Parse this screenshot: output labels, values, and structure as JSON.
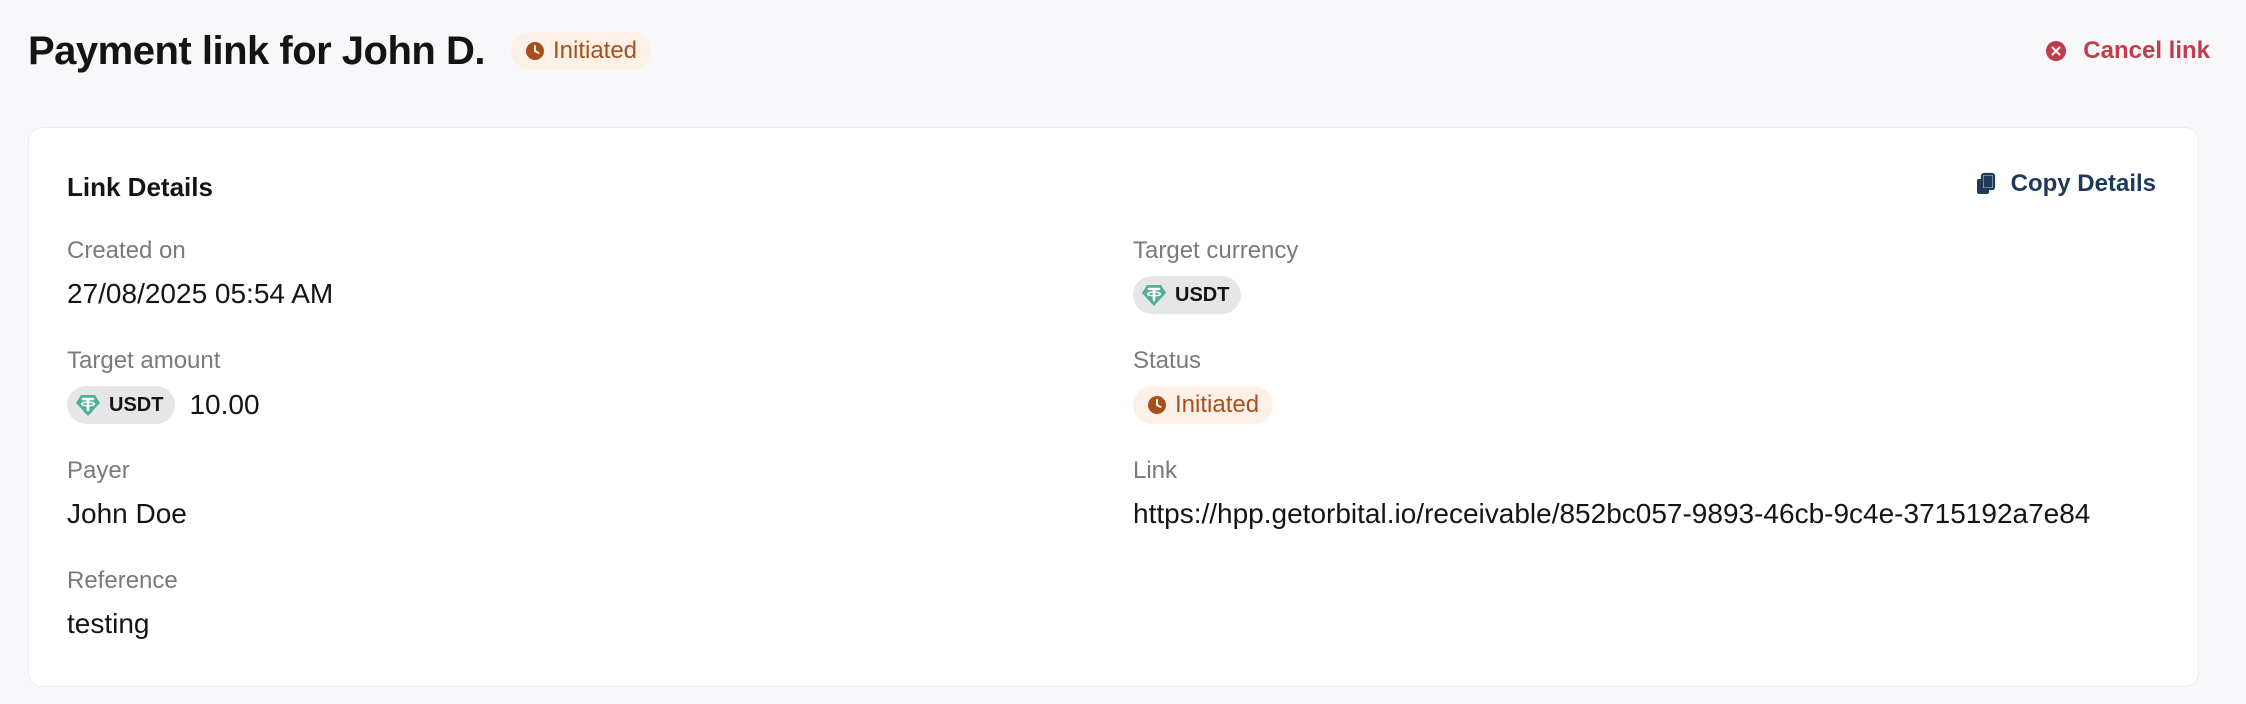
{
  "header": {
    "title": "Payment link for John D.",
    "status": "Initiated",
    "cancel_label": "Cancel link"
  },
  "card": {
    "title": "Link Details",
    "copy_label": "Copy Details",
    "fields": {
      "created_on": {
        "label": "Created on",
        "value": "27/08/2025 05:54 AM"
      },
      "target_amount": {
        "label": "Target amount",
        "currency": "USDT",
        "value": "10.00"
      },
      "payer": {
        "label": "Payer",
        "value": "John Doe"
      },
      "reference": {
        "label": "Reference",
        "value": "testing"
      },
      "target_currency": {
        "label": "Target currency",
        "currency": "USDT"
      },
      "status": {
        "label": "Status",
        "value": "Initiated"
      },
      "link": {
        "label": "Link",
        "value": "https://hpp.getorbital.io/receivable/852bc057-9893-46cb-9c4e-3715192a7e84"
      }
    }
  },
  "icons": {
    "status": "clock-icon",
    "cancel": "x-circle-icon",
    "copy": "copy-icon",
    "currency": "tether-icon"
  },
  "colors": {
    "status_text": "#a8501c",
    "status_bg": "#fdf1e7",
    "cancel": "#c23d4b",
    "copy": "#1d3a5c",
    "tether": "#50af95"
  }
}
